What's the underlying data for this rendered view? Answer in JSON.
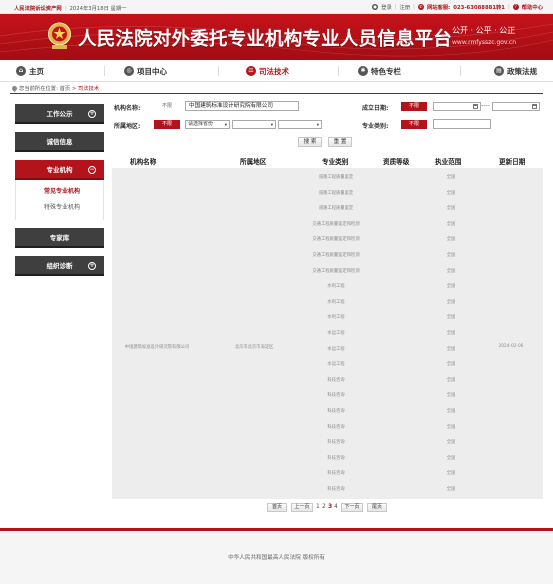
{
  "topbar": {
    "site_name": "人民法院诉讼资产网",
    "date": "2024年3月18日",
    "weekday": "星期一",
    "login": "登录",
    "register": "注册",
    "hotline_label": "网站客服:",
    "hotline_number": "023-63088881转1",
    "help": "帮助中心"
  },
  "header": {
    "title": "人民法院对外委托专业机构专业人员信息平台",
    "motto": "公开 · 公平 · 公正",
    "url": "www.rmfysszc.gov.cn",
    "brand_color": "#b3141b"
  },
  "nav": {
    "items": [
      {
        "label": "主页",
        "icon": "home-icon",
        "active": false
      },
      {
        "label": "项目中心",
        "icon": "compass-icon",
        "active": false
      },
      {
        "label": "司法技术",
        "icon": "scale-icon",
        "active": true
      },
      {
        "label": "特色专栏",
        "icon": "gear-icon",
        "active": false
      },
      {
        "label": "政策法规",
        "icon": "book-icon",
        "active": false
      }
    ]
  },
  "breadcrumb": {
    "prefix": "您当前所在位置:",
    "home": "首页",
    "sep": ">",
    "current": "司法技术"
  },
  "sidebar": {
    "groups": [
      {
        "label": "工作公示",
        "active": false,
        "toggle": "+"
      },
      {
        "label": "诚信信息",
        "active": false,
        "toggle": ""
      },
      {
        "label": "专业机构",
        "active": true,
        "toggle": "−",
        "subitems": [
          "常见专业机构",
          "特殊专业机构"
        ]
      },
      {
        "label": "专家库",
        "active": false,
        "toggle": ""
      },
      {
        "label": "组织诊断",
        "active": false,
        "toggle": "+"
      }
    ]
  },
  "search": {
    "org_name_label": "机构名称:",
    "org_name_tag": "不限",
    "org_name_value": "中国建筑标准设计研究院有限公司",
    "established_label": "成立日期:",
    "established_tag": "不限",
    "date_separator": "----",
    "region_label": "所属地区:",
    "region_tag": "不限",
    "province_placeholder": "请选择省份",
    "category_label": "专业类别:",
    "category_tag": "不限",
    "search_button": "搜 索",
    "reset_button": "重 置"
  },
  "table": {
    "columns": [
      "机构名称",
      "所属地区",
      "专业类别",
      "资质等级",
      "执业范围",
      "更新日期"
    ],
    "org_name": "中国建筑标准设计研究院有限公司",
    "region": "北京市北京市海淀区",
    "update_date": "2024-02-06",
    "rows": [
      {
        "category": "道路工程质量鉴定",
        "scope": "全国"
      },
      {
        "category": "道路工程质量鉴定",
        "scope": "全国"
      },
      {
        "category": "道路工程质量鉴定",
        "scope": "全国"
      },
      {
        "category": "交通工程质量鉴定和检测",
        "scope": "全国"
      },
      {
        "category": "交通工程质量鉴定和检测",
        "scope": "全国"
      },
      {
        "category": "交通工程质量鉴定和检测",
        "scope": "全国"
      },
      {
        "category": "交通工程质量鉴定和检测",
        "scope": "全国"
      },
      {
        "category": "水利工程",
        "scope": "全国"
      },
      {
        "category": "水利工程",
        "scope": "全国"
      },
      {
        "category": "水利工程",
        "scope": "全国"
      },
      {
        "category": "水运工程",
        "scope": "全国"
      },
      {
        "category": "水运工程",
        "scope": "全国"
      },
      {
        "category": "水运工程",
        "scope": "全国"
      },
      {
        "category": "科技咨询",
        "scope": "全国"
      },
      {
        "category": "科技咨询",
        "scope": "全国"
      },
      {
        "category": "科技咨询",
        "scope": "全国"
      },
      {
        "category": "科技咨询",
        "scope": "全国"
      },
      {
        "category": "科技咨询",
        "scope": "全国"
      },
      {
        "category": "科技咨询",
        "scope": "全国"
      },
      {
        "category": "科技咨询",
        "scope": "全国"
      },
      {
        "category": "科技咨询",
        "scope": "全国"
      }
    ]
  },
  "pagination": {
    "first": "首页",
    "prev": "上一页",
    "pages": [
      "1",
      "2",
      "3",
      "4"
    ],
    "current_page": "3",
    "next": "下一页",
    "last": "尾页"
  },
  "footer": {
    "copyright": "中华人民共和国最高人民法院 版权所有"
  }
}
